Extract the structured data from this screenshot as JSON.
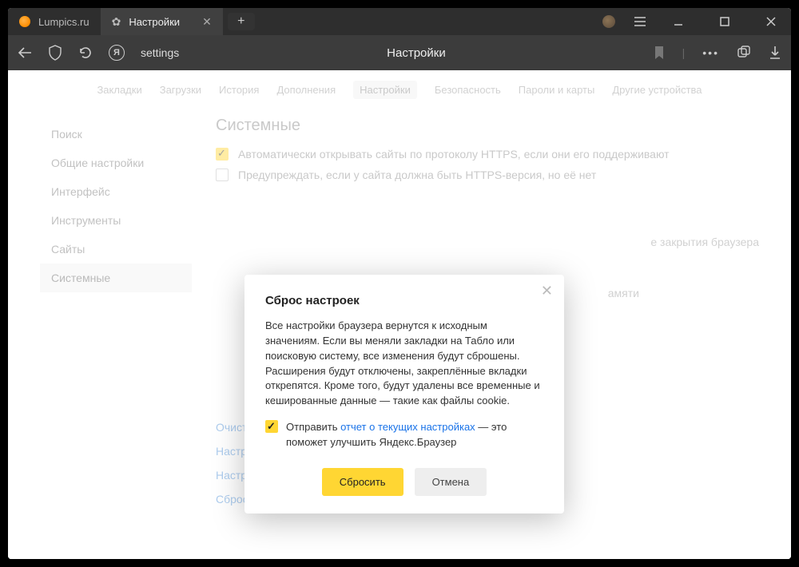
{
  "titlebar": {
    "tabs": [
      {
        "label": "Lumpics.ru"
      },
      {
        "label": "Настройки"
      }
    ]
  },
  "addrbar": {
    "url": "settings",
    "title": "Настройки"
  },
  "subnav": {
    "items": [
      "Закладки",
      "Загрузки",
      "История",
      "Дополнения",
      "Настройки",
      "Безопасность",
      "Пароли и карты",
      "Другие устройства"
    ]
  },
  "sidebar": {
    "items": [
      "Поиск",
      "Общие настройки",
      "Интерфейс",
      "Инструменты",
      "Сайты",
      "Системные"
    ]
  },
  "main": {
    "section_title": "Системные",
    "check1": "Автоматически открывать сайты по протоколу HTTPS, если они его поддерживают",
    "check2": "Предупреждать, если у сайта должна быть HTTPS-версия, но её нет",
    "bg_line1": "е закрытия браузера",
    "bg_line2": "амяти",
    "links": [
      "Очистить историю",
      "Настройки языка и региона",
      "Настройки персональных данных",
      "Сбросить все настройки"
    ]
  },
  "modal": {
    "title": "Сброс настроек",
    "body": "Все настройки браузера вернутся к исходным значениям. Если вы меняли закладки на Табло или поисковую систему, все изменения будут сброшены. Расширения будут отключены, закреплённые вкладки открепятся. Кроме того, будут удалены все временные и кешированные данные — такие как файлы cookie.",
    "chk_prefix": "Отправить ",
    "chk_link": "отчет о текущих настройках",
    "chk_suffix": " — это поможет улучшить Яндекс.Браузер",
    "primary": "Сбросить",
    "secondary": "Отмена"
  }
}
